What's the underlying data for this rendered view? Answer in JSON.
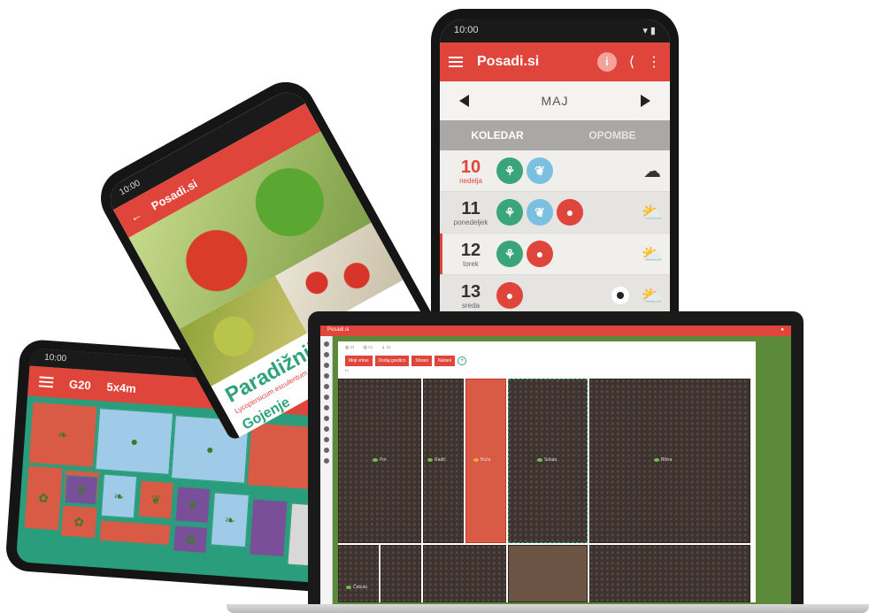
{
  "calendar_phone": {
    "status_time": "10:00",
    "app_title": "Posadi.si",
    "info_label": "i",
    "month": "MAJ",
    "tabs": [
      "KOLEDAR",
      "OPOMBE"
    ],
    "days": [
      {
        "num": "10",
        "weekday": "nedelja",
        "icons": [
          "plant",
          "leaf"
        ],
        "weather": "cloudy"
      },
      {
        "num": "11",
        "weekday": "ponedeljek",
        "icons": [
          "plant",
          "leaf",
          "fruit"
        ],
        "weather": "partly-sunny"
      },
      {
        "num": "12",
        "weekday": "torek",
        "icons": [
          "plant",
          "fruit"
        ],
        "weather": "partly-sunny"
      },
      {
        "num": "13",
        "weekday": "sreda",
        "icons": [
          "fruit"
        ],
        "weather": "partly-sunny"
      }
    ],
    "accent_color": "#e0453b",
    "green_color": "#3aa57a",
    "blue_color": "#7cc0df"
  },
  "article_phone": {
    "status_time": "10:00",
    "app_title": "Posadi.si",
    "title": "Paradižnik",
    "subtitle": "Lycopersicum esculentum",
    "section": "Gojenje"
  },
  "grid_phone": {
    "status_time": "10:00",
    "bed_code": "G20",
    "bed_size": "5x4m",
    "bed_color": "#2a9e7c"
  },
  "laptop": {
    "app_title": "Posadi.si",
    "toolbar_buttons": [
      "Moji vrtovi",
      "Dodaj gredico",
      "Shrani",
      "Natisni"
    ],
    "plot_labels": [
      "Por",
      "Radič",
      "Buča",
      "Solata",
      "Blitva",
      "Čebula"
    ]
  }
}
